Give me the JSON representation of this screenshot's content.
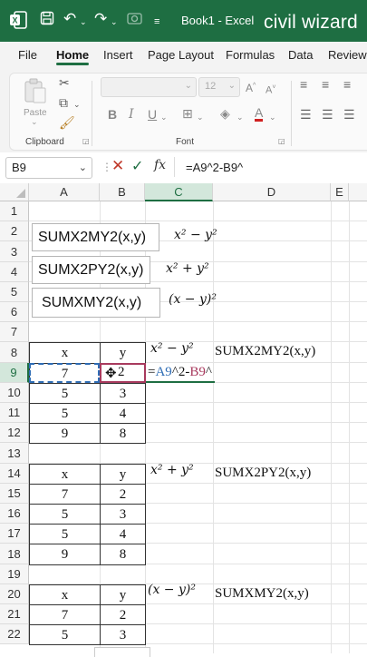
{
  "titlebar": {
    "title": "Book1  -  Excel",
    "brand": "civil wizard",
    "icons": [
      "excel-logo-icon",
      "save-icon",
      "undo-icon",
      "redo-icon",
      "camera-icon",
      "customize-icon"
    ]
  },
  "tabs": [
    "File",
    "Home",
    "Insert",
    "Page Layout",
    "Formulas",
    "Data",
    "Review"
  ],
  "active_tab": "Home",
  "ribbon": {
    "clipboard_label": "Clipboard",
    "paste_label": "Paste",
    "font_label": "Font",
    "font_size": "12"
  },
  "formula_bar": {
    "name_box": "B9",
    "fx": "fx",
    "content": "=A9^2-B9^"
  },
  "columns": [
    "A",
    "B",
    "C",
    "D",
    "E"
  ],
  "rows": [
    "1",
    "2",
    "3",
    "4",
    "5",
    "6",
    "7",
    "8",
    "9",
    "10",
    "11",
    "12",
    "13",
    "14",
    "15",
    "16",
    "17",
    "18",
    "19",
    "20",
    "21",
    "22"
  ],
  "function_boxes": [
    {
      "text": "SUMX2MY2(x,y)",
      "math": "x² − y²"
    },
    {
      "text": "SUMX2PY2(x,y)",
      "math": "x² + y²"
    },
    {
      "text": "SUMXMY2(x,y)",
      "math": "(x − y)²"
    }
  ],
  "tables": [
    {
      "header": [
        "x",
        "y"
      ],
      "rows": [
        [
          "7",
          "2"
        ],
        [
          "5",
          "3"
        ],
        [
          "5",
          "4"
        ],
        [
          "9",
          "8"
        ]
      ],
      "math": "x² − y²",
      "func": "SUMX2MY2(x,y)"
    },
    {
      "header": [
        "x",
        "y"
      ],
      "rows": [
        [
          "7",
          "2"
        ],
        [
          "5",
          "3"
        ],
        [
          "5",
          "4"
        ],
        [
          "9",
          "8"
        ]
      ],
      "math": "x² + y²",
      "func": "SUMX2PY2(x,y)"
    },
    {
      "header": [
        "x",
        "y"
      ],
      "rows": [
        [
          "7",
          "2"
        ],
        [
          "5",
          "3"
        ]
      ],
      "math": "(x − y)²",
      "func": "SUMXMY2(x,y)"
    }
  ],
  "editing": {
    "prefix": "=",
    "ref1": "A9",
    "mid": "^2-",
    "ref2": "B9",
    "suffix": "^"
  },
  "colors": {
    "excel_green": "#1e6e42",
    "ref1_color": "#2f6db5",
    "ref2_color": "#a83a5e"
  }
}
